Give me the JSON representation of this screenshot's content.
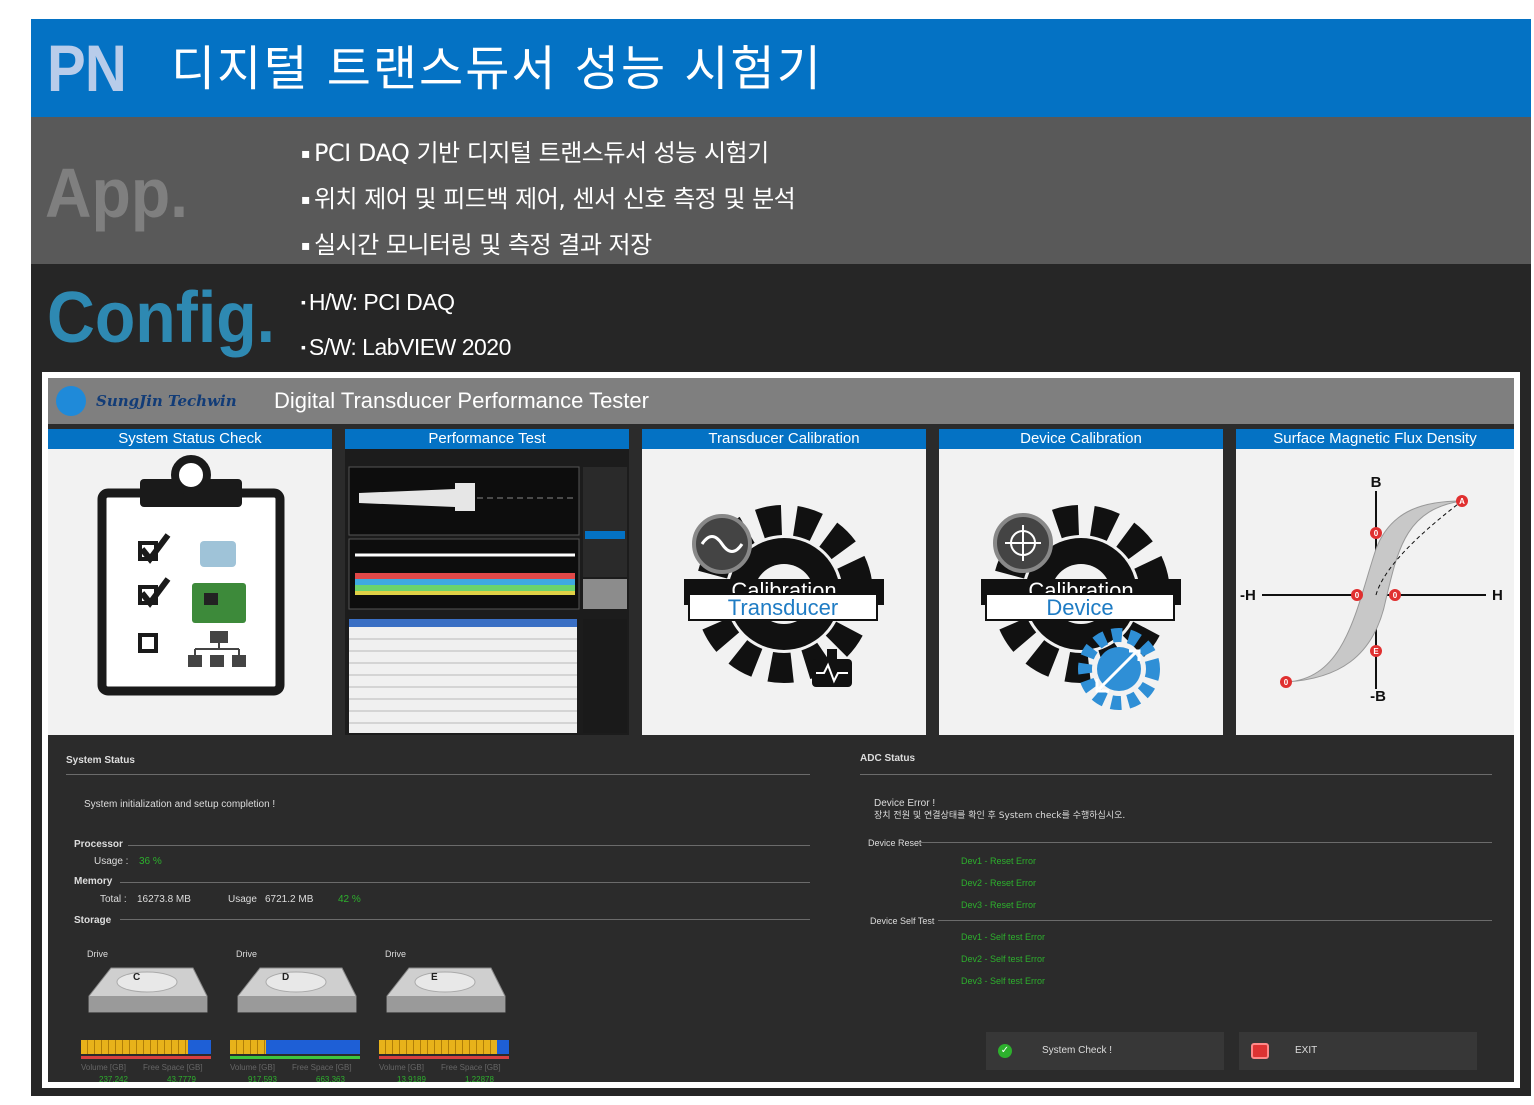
{
  "header": {
    "badge": "PN",
    "title": "디지털 트랜스듀서 성능 시험기"
  },
  "app_section": {
    "label": "App.",
    "bullets": [
      "PCI DAQ 기반 디지털 트랜스듀서 성능 시험기",
      "위치 제어 및 피드백 제어, 센서 신호 측정 및 분석",
      "실시간 모니터링 및 측정 결과 저장"
    ]
  },
  "config_section": {
    "label": "Config.",
    "bullets": [
      "H/W: PCI DAQ",
      "S/W: LabVIEW 2020"
    ]
  },
  "window": {
    "logo_text": "SungJin Techwin",
    "title": "Digital Transducer Performance Tester",
    "modules": [
      {
        "label": "System Status Check",
        "icon": "checklist-icon"
      },
      {
        "label": "Performance Test",
        "icon": "performance-screen-thumbnail"
      },
      {
        "label": "Transducer Calibration",
        "icon": "transducer-gear-icon",
        "gear_top": "Calibration",
        "gear_bottom": "Transducer"
      },
      {
        "label": "Device Calibration",
        "icon": "device-gear-icon",
        "gear_top": "Calibration",
        "gear_bottom": "Device"
      },
      {
        "label": "Surface Magnetic Flux Density",
        "icon": "hysteresis-curve-icon",
        "axis": {
          "B": "B",
          "nB": "-B",
          "H": "H",
          "nH": "-H"
        },
        "points": [
          "A",
          "0",
          "0",
          "0",
          "E",
          "0"
        ]
      }
    ],
    "system_status": {
      "title": "System Status",
      "message": "System initialization and setup completion !",
      "processor": {
        "label": "Processor",
        "usage_label": "Usage :",
        "usage_value": "36 %"
      },
      "memory": {
        "label": "Memory",
        "total_label": "Total :",
        "total_value": "16273.8 MB",
        "usage_label": "Usage",
        "usage_value": "6721.2 MB",
        "usage_pct": "42 %"
      },
      "storage": {
        "label": "Storage",
        "drives": [
          {
            "caption": "Drive",
            "letter": "C",
            "volume_label": "Volume [GB]",
            "free_label": "Free Space [GB]",
            "volume": "237.242",
            "free": "43.7779",
            "used_fraction": 0.82,
            "color": "#e8b21a"
          },
          {
            "caption": "Drive",
            "letter": "D",
            "volume_label": "Volume [GB]",
            "free_label": "Free Space [GB]",
            "volume": "917.593",
            "free": "663.363",
            "used_fraction": 0.28,
            "color": "#e8b21a"
          },
          {
            "caption": "Drive",
            "letter": "E",
            "volume_label": "Volume [GB]",
            "free_label": "Free Space [GB]",
            "volume": "13.9189",
            "free": "1.22878",
            "used_fraction": 0.91,
            "color": "#e8b21a"
          }
        ]
      }
    },
    "adc_status": {
      "title": "ADC Status",
      "error_title": "Device Error !",
      "error_detail": "장치 전원 및 연결상태를 확인 후 System check를 수행하십시오.",
      "reset_label": "Device Reset",
      "reset_items": [
        "Dev1 - Reset Error",
        "Dev2 - Reset Error",
        "Dev3 - Reset Error"
      ],
      "selftest_label": "Device Self Test",
      "selftest_items": [
        "Dev1 - Self test Error",
        "Dev2 - Self test Error",
        "Dev3 - Self test Error"
      ]
    },
    "buttons": {
      "system_check": "System Check !",
      "exit": "EXIT"
    }
  }
}
